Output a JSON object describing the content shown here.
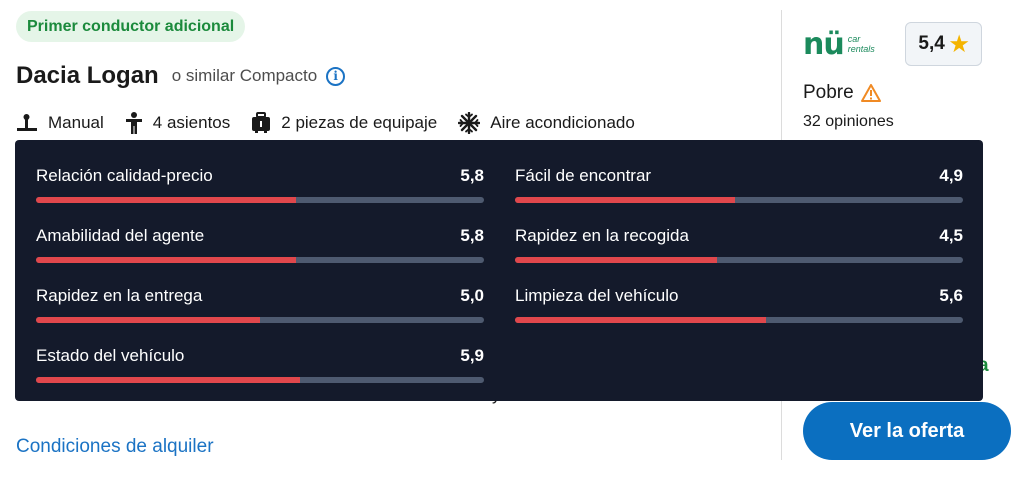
{
  "badge": "Primer conductor adicional",
  "car": {
    "name": "Dacia Logan",
    "similar": "o similar Compacto",
    "info_icon": "info-icon"
  },
  "features": [
    {
      "icon": "transmission-icon",
      "label": "Manual"
    },
    {
      "icon": "person-icon",
      "label": "4 asientos"
    },
    {
      "icon": "luggage-icon",
      "label": "2 piezas de equipaje"
    },
    {
      "icon": "snowflake-icon",
      "label": "Aire acondicionado"
    }
  ],
  "supplier": {
    "logo_main": "nü",
    "logo_sub_1": "car",
    "logo_sub_2": "rentals",
    "score": "5,4",
    "score_icon": "star-icon",
    "rating_label": "Pobre",
    "rating_icon": "warning-icon",
    "reviews": "32 opiniones"
  },
  "tooltip": {
    "max_score": 10,
    "metrics": [
      {
        "label": "Relación calidad-precio",
        "score": "5,8",
        "value": 5.8
      },
      {
        "label": "Fácil de encontrar",
        "score": "4,9",
        "value": 4.9
      },
      {
        "label": "Amabilidad del agente",
        "score": "5,8",
        "value": 5.8
      },
      {
        "label": "Rapidez en la recogida",
        "score": "4,5",
        "value": 4.5
      },
      {
        "label": "Rapidez en la entrega",
        "score": "5,0",
        "value": 5.0
      },
      {
        "label": "Limpieza del vehículo",
        "score": "5,6",
        "value": 5.6
      },
      {
        "label": "Estado del vehículo",
        "score": "5,9",
        "value": 5.9
      }
    ]
  },
  "partial": {
    "green_glyph": "a",
    "dark_glyph": "y"
  },
  "links": {
    "conditions": "Condiciones de alquiler"
  },
  "cta": {
    "label": "Ver la oferta"
  },
  "colors": {
    "accent_blue": "#0b6fc0",
    "badge_green": "#1b8a3c",
    "tooltip_bg": "#141a2b",
    "bar_fill": "#e0474c",
    "bar_track": "#4e5a70",
    "warning": "#f08a24",
    "star": "#f4b400"
  }
}
